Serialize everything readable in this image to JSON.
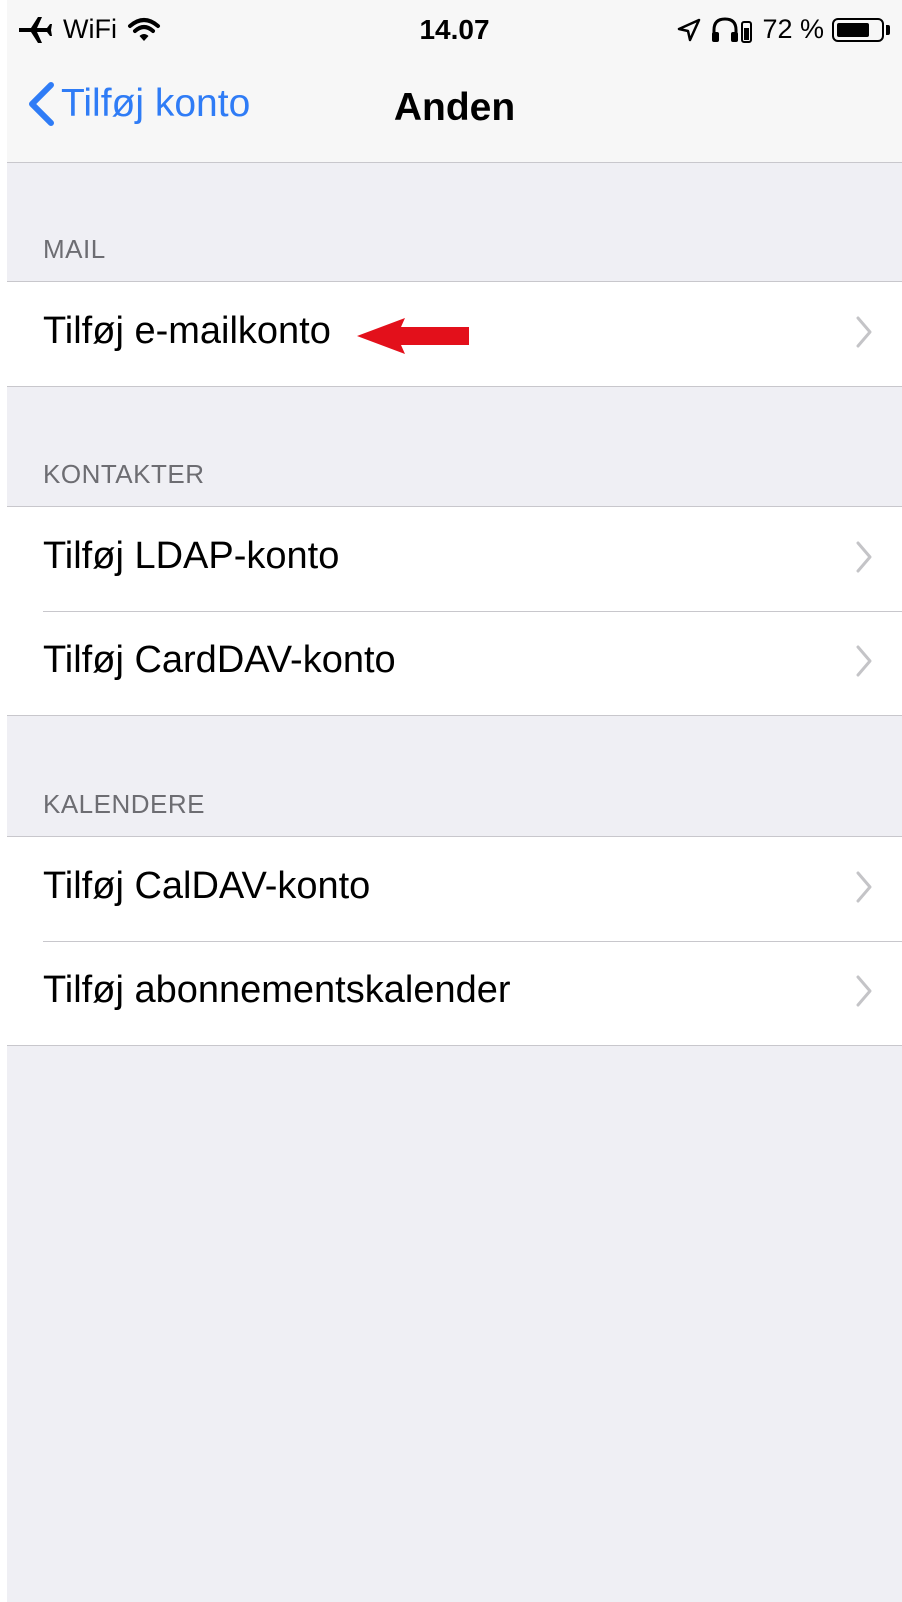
{
  "status_bar": {
    "carrier": "WiFi",
    "time": "14.07",
    "battery_percent": "72 %",
    "battery_level": 0.72,
    "icons": [
      "airplane-icon",
      "wifi-icon",
      "location-icon",
      "headphones-icon",
      "battery-icon"
    ]
  },
  "nav": {
    "back_label": "Tilføj konto",
    "title": "Anden"
  },
  "sections": [
    {
      "header": "MAIL",
      "items": [
        {
          "label": "Tilføj e-mailkonto"
        }
      ]
    },
    {
      "header": "KONTAKTER",
      "items": [
        {
          "label": "Tilføj LDAP-konto"
        },
        {
          "label": "Tilføj CardDAV-konto"
        }
      ]
    },
    {
      "header": "KALENDERE",
      "items": [
        {
          "label": "Tilføj CalDAV-konto"
        },
        {
          "label": "Tilføj abonnementskalender"
        }
      ]
    }
  ],
  "colors": {
    "accent": "#2f7cf6",
    "annotation_arrow": "#e3101b",
    "background": "#efeff4"
  }
}
